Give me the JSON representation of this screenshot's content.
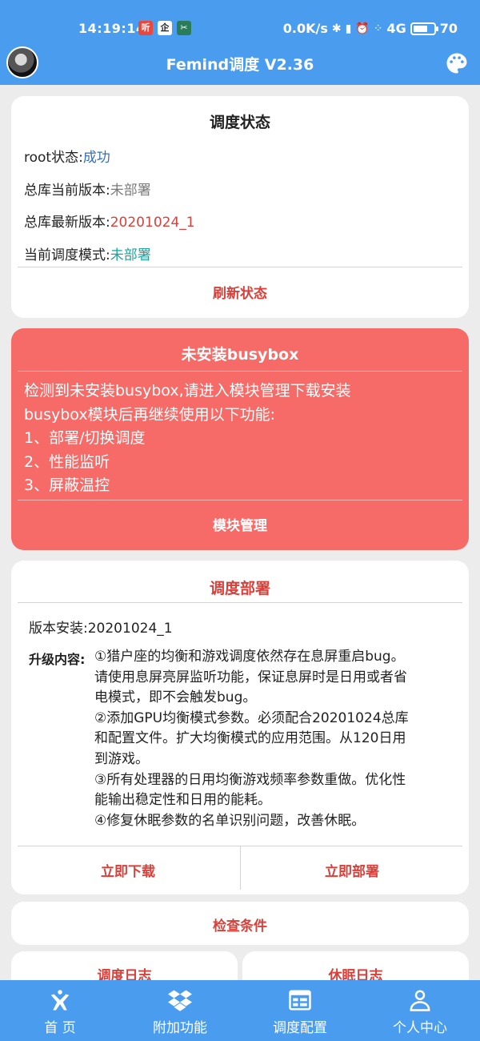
{
  "statusbar": {
    "time": "14:19:14",
    "notif_icons": [
      "听",
      "企",
      "✂"
    ],
    "net_speed": "0.0K/s",
    "net_type": "4G",
    "battery": "70",
    "battery_level": 0.7
  },
  "header": {
    "title": "Femind调度 V2.36"
  },
  "status_card": {
    "title": "调度状态",
    "rows": [
      {
        "label": "root状态:",
        "value": "成功",
        "color": "#3a6fb0"
      },
      {
        "label": "总库当前版本:",
        "value": "未部署",
        "color": "#7a7a7a"
      },
      {
        "label": "总库最新版本:",
        "value": "20201024_1",
        "color": "#d9403a"
      },
      {
        "label": "当前调度模式:",
        "value": "未部署",
        "color": "#1aa3a0"
      }
    ],
    "refresh_label": "刷新状态"
  },
  "busybox_card": {
    "title": "未安装busybox",
    "lines": [
      "检测到未安装busybox,请进入模块管理下载安装",
      "busybox模块后再继续使用以下功能:",
      "1、部署/切换调度",
      "2、性能监听",
      "3、屏蔽温控"
    ],
    "button_label": "模块管理"
  },
  "deploy_card": {
    "title": "调度部署",
    "version_label": "版本安装:",
    "version_value": "20201024_1",
    "upgrade_label": "升级内容:",
    "upgrade_lines": [
      "①猎户座的均衡和游戏调度依然存在息屏重启bug。",
      "请使用息屏亮屏监听功能，保证息屏时是日用或者省",
      "电模式，即不会触发bug。",
      "②添加GPU均衡模式参数。必须配合20201024总库",
      "和配置文件。扩大均衡模式的应用范围。从120日用",
      "到游戏。",
      "③所有处理器的日用均衡游戏频率参数重做。优化性",
      "能输出稳定性和日用的能耗。",
      "④修复休眠参数的名单识别问题，改善休眠。"
    ],
    "download_label": "立即下载",
    "deploy_label": "立即部署"
  },
  "check_label": "检查条件",
  "log_labels": [
    "调度日志",
    "休眠日志"
  ],
  "nav": [
    {
      "label": "首  页",
      "icon": "home-icon"
    },
    {
      "label": "附加功能",
      "icon": "dropbox-icon"
    },
    {
      "label": "调度配置",
      "icon": "config-icon"
    },
    {
      "label": "个人中心",
      "icon": "user-icon"
    }
  ],
  "colors": {
    "primary": "#4a9cef",
    "accent_red": "#d9403a",
    "warning_bg": "#f66b67"
  }
}
